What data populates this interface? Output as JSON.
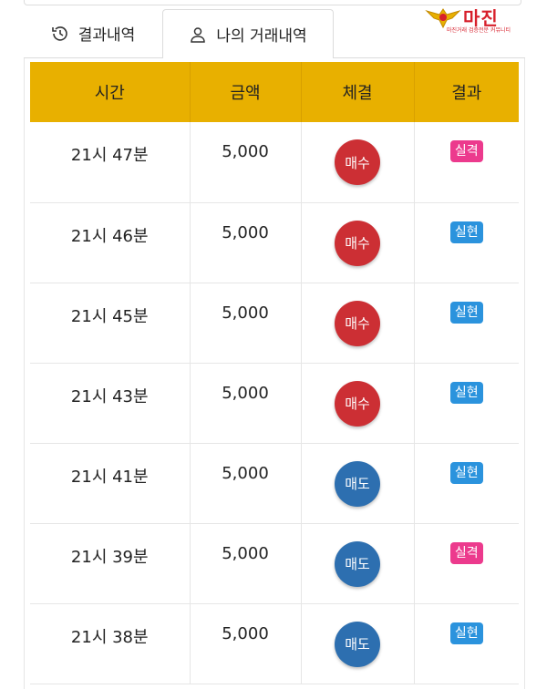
{
  "tabs": [
    {
      "label": "결과내역",
      "icon": "history-icon"
    },
    {
      "label": "나의 거래내역",
      "icon": "user-icon"
    }
  ],
  "logo": {
    "text": "마진",
    "subtext": "마진거래 검증전문 커뮤니티",
    "color": "#d71f2b"
  },
  "table": {
    "headers": [
      "시간",
      "금액",
      "체결",
      "결과"
    ],
    "header_color": "#e8b000",
    "rows": [
      {
        "time": "21시 47분",
        "amount": "5,000",
        "trade": "매수",
        "result": "실격"
      },
      {
        "time": "21시 46분",
        "amount": "5,000",
        "trade": "매수",
        "result": "실현"
      },
      {
        "time": "21시 45분",
        "amount": "5,000",
        "trade": "매수",
        "result": "실현"
      },
      {
        "time": "21시 43분",
        "amount": "5,000",
        "trade": "매수",
        "result": "실현"
      },
      {
        "time": "21시 41분",
        "amount": "5,000",
        "trade": "매도",
        "result": "실현"
      },
      {
        "time": "21시 39분",
        "amount": "5,000",
        "trade": "매도",
        "result": "실격"
      },
      {
        "time": "21시 38분",
        "amount": "5,000",
        "trade": "매도",
        "result": "실현"
      }
    ]
  },
  "colors": {
    "buy": "#cc2f34",
    "sell": "#2d6fb0",
    "fail": "#ec3a8d",
    "win": "#2b93dd"
  }
}
